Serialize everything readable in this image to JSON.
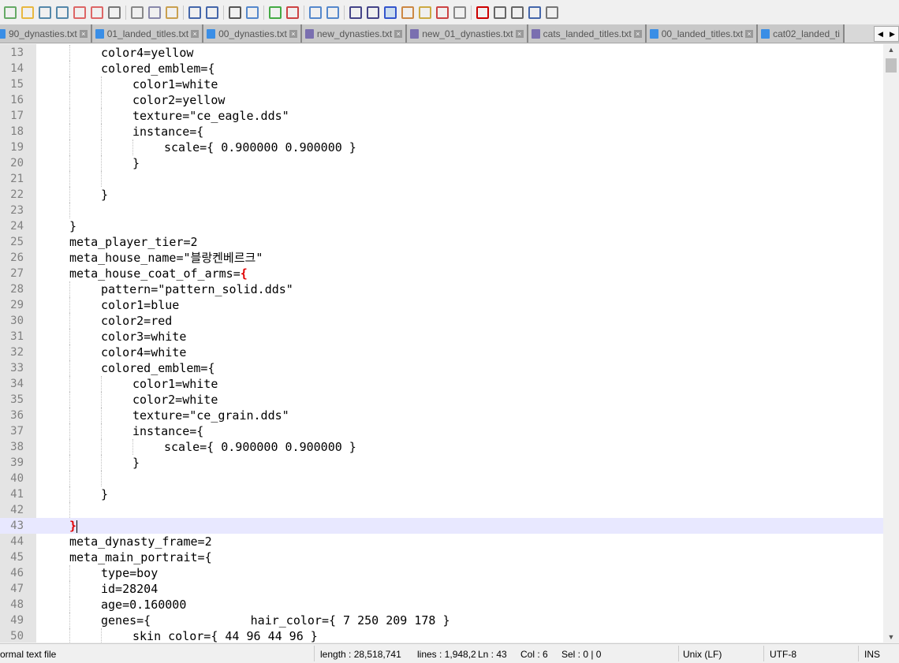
{
  "toolbar": {
    "icons": [
      "new-file",
      "open-file",
      "save",
      "save-all",
      "close",
      "close-all",
      "print",
      "cut",
      "copy",
      "paste",
      "undo",
      "redo",
      "find",
      "replace",
      "zoom-in",
      "zoom-out",
      "sync-vertical",
      "sync-horizontal",
      "word-wrap",
      "show-all-chars",
      "indent-guide",
      "doc-map",
      "function-list",
      "folder-workspace",
      "monitoring",
      "record-macro",
      "stop-macro",
      "play-macro",
      "run-macro-multiple",
      "save-macro"
    ]
  },
  "tabs": [
    {
      "label": "90_dynasties.txt",
      "saved": true
    },
    {
      "label": "01_landed_titles.txt",
      "saved": true
    },
    {
      "label": "00_dynasties.txt",
      "saved": true
    },
    {
      "label": "new_dynasties.txt",
      "saved": false
    },
    {
      "label": "new_01_dynasties.txt",
      "saved": false
    },
    {
      "label": "cats_landed_titles.txt",
      "saved": false
    },
    {
      "label": "00_landed_titles.txt",
      "saved": true
    },
    {
      "label": "cat02_landed_ti",
      "saved": true
    }
  ],
  "editor": {
    "current_line": 43,
    "lines": [
      {
        "n": 13,
        "i": 2,
        "t": "color4=yellow"
      },
      {
        "n": 14,
        "i": 2,
        "t": "colored_emblem={"
      },
      {
        "n": 15,
        "i": 3,
        "t": "color1=white"
      },
      {
        "n": 16,
        "i": 3,
        "t": "color2=yellow"
      },
      {
        "n": 17,
        "i": 3,
        "t": "texture=\"ce_eagle.dds\""
      },
      {
        "n": 18,
        "i": 3,
        "t": "instance={"
      },
      {
        "n": 19,
        "i": 4,
        "t": "scale={ 0.900000 0.900000 }"
      },
      {
        "n": 20,
        "i": 3,
        "t": "}"
      },
      {
        "n": 21,
        "i": 3,
        "t": ""
      },
      {
        "n": 22,
        "i": 2,
        "t": "}"
      },
      {
        "n": 23,
        "i": 2,
        "t": ""
      },
      {
        "n": 24,
        "i": 1,
        "t": "}"
      },
      {
        "n": 25,
        "i": 1,
        "t": "meta_player_tier=2"
      },
      {
        "n": 26,
        "i": 1,
        "t": "meta_house_name=\"블랑켄베르크\""
      },
      {
        "n": 27,
        "i": 1,
        "t": "meta_house_coat_of_arms=",
        "hl": "{"
      },
      {
        "n": 28,
        "i": 2,
        "t": "pattern=\"pattern_solid.dds\""
      },
      {
        "n": 29,
        "i": 2,
        "t": "color1=blue"
      },
      {
        "n": 30,
        "i": 2,
        "t": "color2=red"
      },
      {
        "n": 31,
        "i": 2,
        "t": "color3=white"
      },
      {
        "n": 32,
        "i": 2,
        "t": "color4=white"
      },
      {
        "n": 33,
        "i": 2,
        "t": "colored_emblem={"
      },
      {
        "n": 34,
        "i": 3,
        "t": "color1=white"
      },
      {
        "n": 35,
        "i": 3,
        "t": "color2=white"
      },
      {
        "n": 36,
        "i": 3,
        "t": "texture=\"ce_grain.dds\""
      },
      {
        "n": 37,
        "i": 3,
        "t": "instance={"
      },
      {
        "n": 38,
        "i": 4,
        "t": "scale={ 0.900000 0.900000 }"
      },
      {
        "n": 39,
        "i": 3,
        "t": "}"
      },
      {
        "n": 40,
        "i": 3,
        "t": ""
      },
      {
        "n": 41,
        "i": 2,
        "t": "}"
      },
      {
        "n": 42,
        "i": 2,
        "t": ""
      },
      {
        "n": 43,
        "i": 1,
        "t": "",
        "hl": "}"
      },
      {
        "n": 44,
        "i": 1,
        "t": "meta_dynasty_frame=2"
      },
      {
        "n": 45,
        "i": 1,
        "t": "meta_main_portrait={"
      },
      {
        "n": 46,
        "i": 2,
        "t": "type=boy"
      },
      {
        "n": 47,
        "i": 2,
        "t": "id=28204"
      },
      {
        "n": 48,
        "i": 2,
        "t": "age=0.160000"
      },
      {
        "n": 49,
        "i": 2,
        "t": "genes={              hair_color={ 7 250 209 178 }"
      },
      {
        "n": 50,
        "i": 3,
        "t": "skin_color={ 44 96 44 96 }"
      }
    ]
  },
  "status": {
    "file_type": "ormal text file",
    "length": "length : 28,518,741",
    "lines": "lines : 1,948,2",
    "ln": "Ln : 43",
    "col": "Col : 6",
    "sel": "Sel : 0 | 0",
    "eol": "Unix (LF)",
    "encoding": "UTF-8",
    "mode": "INS"
  }
}
